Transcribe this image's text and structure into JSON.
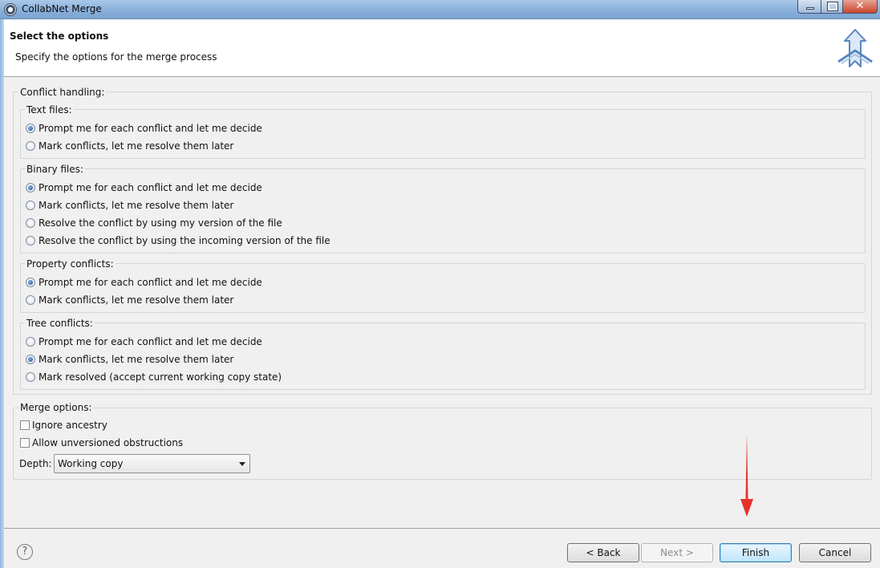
{
  "window": {
    "title": "CollabNet Merge"
  },
  "header": {
    "title": "Select the options",
    "description": "Specify the options for the merge process"
  },
  "conflict_handling": {
    "label": "Conflict handling:",
    "text_files": {
      "label": "Text files:",
      "options": [
        {
          "label": "Prompt me for each conflict and let me decide",
          "selected": true
        },
        {
          "label": "Mark conflicts, let me resolve them later",
          "selected": false
        }
      ]
    },
    "binary_files": {
      "label": "Binary files:",
      "options": [
        {
          "label": "Prompt me for each conflict and let me decide",
          "selected": true
        },
        {
          "label": "Mark conflicts, let me resolve them later",
          "selected": false
        },
        {
          "label": "Resolve the conflict by using my version of the file",
          "selected": false
        },
        {
          "label": "Resolve the conflict by using the incoming version of the file",
          "selected": false
        }
      ]
    },
    "property_conflicts": {
      "label": "Property conflicts:",
      "options": [
        {
          "label": "Prompt me for each conflict and let me decide",
          "selected": true
        },
        {
          "label": "Mark conflicts, let me resolve them later",
          "selected": false
        }
      ]
    },
    "tree_conflicts": {
      "label": "Tree conflicts:",
      "options": [
        {
          "label": "Prompt me for each conflict and let me decide",
          "selected": false
        },
        {
          "label": "Mark conflicts, let me resolve them later",
          "selected": true
        },
        {
          "label": "Mark resolved (accept current working copy state)",
          "selected": false
        }
      ]
    }
  },
  "merge_options": {
    "label": "Merge options:",
    "ignore_ancestry": {
      "label": "Ignore ancestry",
      "checked": false
    },
    "allow_unversioned": {
      "label": "Allow unversioned obstructions",
      "checked": false
    },
    "depth": {
      "label": "Depth:",
      "value": "Working copy"
    }
  },
  "footer": {
    "help_icon": "?",
    "back": "< Back",
    "next": "Next >",
    "finish": "Finish",
    "cancel": "Cancel"
  },
  "colors": {
    "annotation_arrow": "#e8302a",
    "default_button": "#3c7fb1"
  }
}
